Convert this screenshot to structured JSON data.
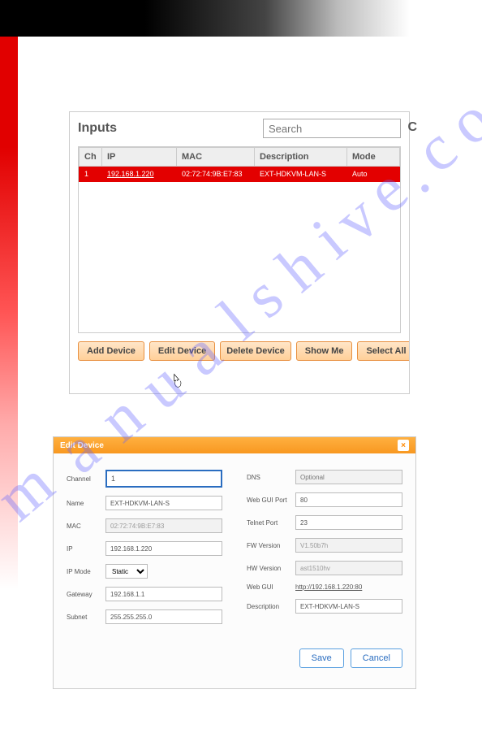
{
  "inputs_panel": {
    "title": "Inputs",
    "search_placeholder": "Search",
    "cutoff": "C",
    "columns": {
      "ch": "Ch",
      "ip": "IP",
      "mac": "MAC",
      "desc": "Description",
      "mode": "Mode"
    },
    "rows": [
      {
        "ch": "1",
        "ip": "192.168.1.220",
        "mac": "02:72:74:9B:E7:83",
        "desc": "EXT-HDKVM-LAN-S",
        "mode": "Auto"
      }
    ],
    "buttons": {
      "add": "Add Device",
      "edit": "Edit Device",
      "delete": "Delete Device",
      "show": "Show Me",
      "select": "Select All"
    }
  },
  "edit_panel": {
    "title": "Edit Device",
    "left": {
      "channel_label": "Channel",
      "channel_value": "1",
      "name_label": "Name",
      "name_value": "EXT-HDKVM-LAN-S",
      "mac_label": "MAC",
      "mac_value": "02:72:74:9B:E7:83",
      "ip_label": "IP",
      "ip_value": "192.168.1.220",
      "ipmode_label": "IP Mode",
      "ipmode_value": "Static",
      "gateway_label": "Gateway",
      "gateway_value": "192.168.1.1",
      "subnet_label": "Subnet",
      "subnet_value": "255.255.255.0"
    },
    "right": {
      "dns_label": "DNS",
      "dns_value": "Optional",
      "webport_label": "Web GUI Port",
      "webport_value": "80",
      "telnet_label": "Telnet Port",
      "telnet_value": "23",
      "fw_label": "FW Version",
      "fw_value": "V1.50b7h",
      "hw_label": "HW Version",
      "hw_value": "ast1510hv",
      "webgui_label": "Web GUI",
      "webgui_value": "http://192.168.1.220:80",
      "desc_label": "Description",
      "desc_value": "EXT-HDKVM-LAN-S"
    },
    "footer": {
      "save": "Save",
      "cancel": "Cancel"
    }
  },
  "watermark": "manualshive.com"
}
